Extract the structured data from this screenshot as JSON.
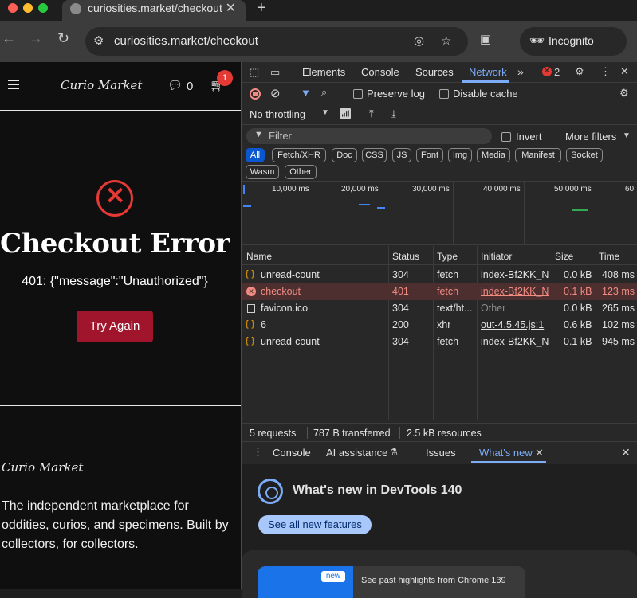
{
  "browser": {
    "tab_title": "curiosities.market/checkout",
    "url": "curiosities.market/checkout",
    "incognito_label": "Incognito",
    "new_tab_symbol": "+"
  },
  "site": {
    "logo": "Curio Market",
    "chat_count": "0",
    "cart_badge": "1",
    "error_title": "Checkout Error",
    "error_message": "401: {\"message\":\"Unauthorized\"}",
    "try_again_label": "Try Again",
    "footer_logo": "Curio Market",
    "footer_text": "The independent marketplace for oddities, curios, and specimens. Built by collectors, for collectors."
  },
  "devtools": {
    "tabs": [
      "Elements",
      "Console",
      "Sources",
      "Network"
    ],
    "active_tab": "Network",
    "error_count": "2",
    "preserve_log": "Preserve log",
    "disable_cache": "Disable cache",
    "throttling": "No throttling",
    "filter_placeholder": "Filter",
    "invert": "Invert",
    "more_filters": "More filters",
    "chips": [
      "All",
      "Fetch/XHR",
      "Doc",
      "CSS",
      "JS",
      "Font",
      "Img",
      "Media",
      "Manifest",
      "Socket",
      "Wasm",
      "Other"
    ],
    "timeline_ticks": [
      "10,000 ms",
      "20,000 ms",
      "30,000 ms",
      "40,000 ms",
      "50,000 ms",
      "60"
    ],
    "columns": [
      "Name",
      "Status",
      "Type",
      "Initiator",
      "Size",
      "Time"
    ],
    "rows": [
      {
        "name": "unread-count",
        "status": "304",
        "type": "fetch",
        "initiator": "index-Bf2KK_N",
        "size": "0.0 kB",
        "time": "408 ms"
      },
      {
        "name": "checkout",
        "status": "401",
        "type": "fetch",
        "initiator": "index-Bf2KK_N",
        "size": "0.1 kB",
        "time": "123 ms"
      },
      {
        "name": "favicon.ico",
        "status": "304",
        "type": "text/ht...",
        "initiator": "Other",
        "size": "0.0 kB",
        "time": "265 ms"
      },
      {
        "name": "6",
        "status": "200",
        "type": "xhr",
        "initiator": "out-4.5.45.js:1",
        "size": "0.6 kB",
        "time": "102 ms"
      },
      {
        "name": "unread-count",
        "status": "304",
        "type": "fetch",
        "initiator": "index-Bf2KK_N",
        "size": "0.1 kB",
        "time": "945 ms"
      }
    ],
    "status_requests": "5 requests",
    "status_transferred": "787 B transferred",
    "status_resources": "2.5 kB resources",
    "drawer_tabs": [
      "Console",
      "AI assistance",
      "Issues",
      "What's new"
    ],
    "whats_new_title": "What's new in DevTools 140",
    "see_all": "See all new features",
    "new_badge": "new",
    "highlights": "See past highlights from Chrome 139"
  }
}
